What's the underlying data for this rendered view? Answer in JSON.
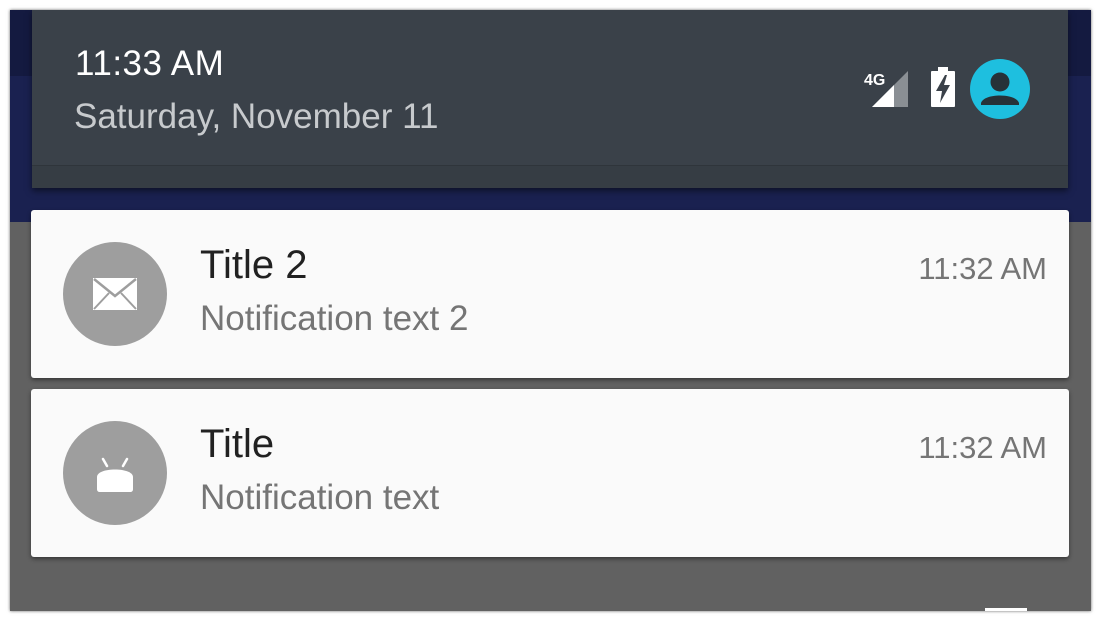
{
  "status_bar": {
    "time": "11:33 AM",
    "date": "Saturday, November 11",
    "network_label": "4G",
    "icons": [
      "signal-icon",
      "battery-charging-icon",
      "user-avatar-icon"
    ]
  },
  "notifications": [
    {
      "icon": "mail-icon",
      "title": "Title 2",
      "text": "Notification text 2",
      "time": "11:32 AM"
    },
    {
      "icon": "android-icon",
      "title": "Title",
      "text": "Notification text",
      "time": "11:32 AM"
    }
  ],
  "colors": {
    "header_bg": "#3a4149",
    "app_bar": "#1a2150",
    "scrim": "#616161",
    "avatar_accent": "#1ebfdf",
    "icon_circle": "#9e9e9e",
    "card_bg": "#fafafa"
  }
}
